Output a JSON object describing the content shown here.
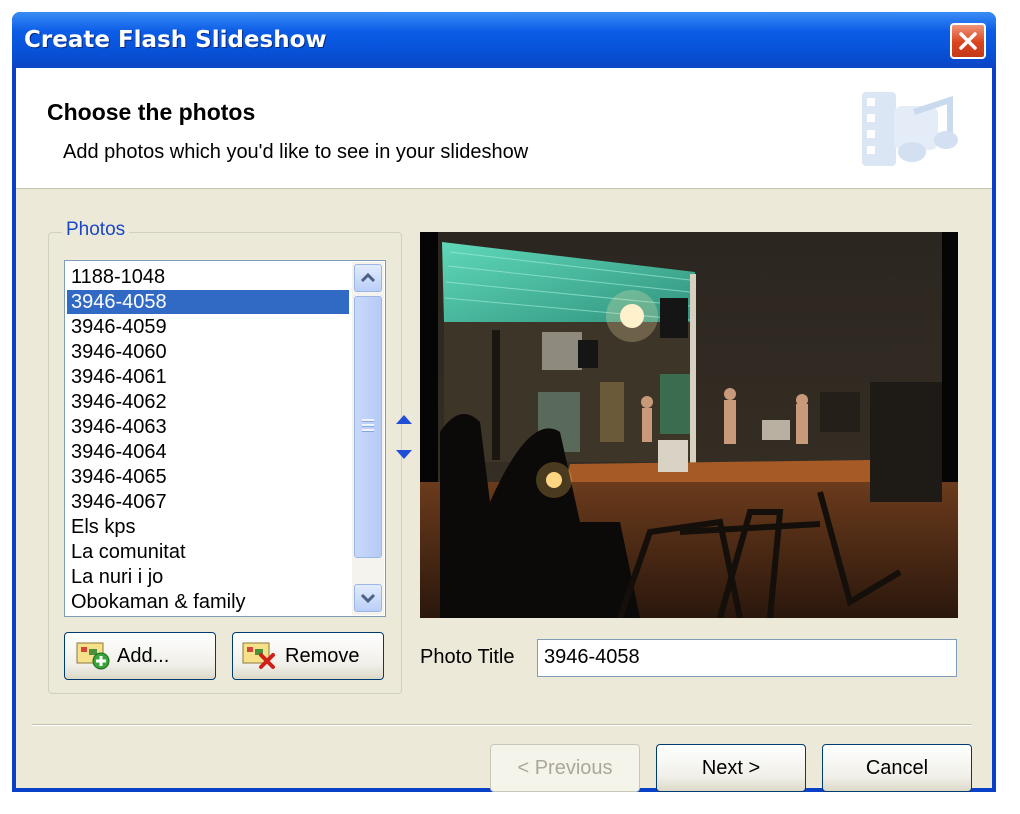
{
  "window": {
    "title": "Create Flash Slideshow"
  },
  "header": {
    "title": "Choose the photos",
    "subtitle": "Add photos which you'd like to see in your slideshow"
  },
  "photos_group": {
    "label": "Photos",
    "items": [
      "1188-1048",
      "3946-4058",
      "3946-4059",
      "3946-4060",
      "3946-4061",
      "3946-4062",
      "3946-4063",
      "3946-4064",
      "3946-4065",
      "3946-4067",
      "Els kps",
      "La comunitat",
      "La nuri i jo",
      "Obokaman & family"
    ],
    "selected_index": 1,
    "add_label": "Add...",
    "remove_label": "Remove"
  },
  "photo_title": {
    "label": "Photo Title",
    "value": "3946-4058"
  },
  "footer": {
    "previous_label": "< Previous",
    "next_label": "Next >",
    "cancel_label": "Cancel"
  },
  "colors": {
    "titlebar": "#0852d8",
    "selection": "#316ac5",
    "dialog_bg": "#ece9d8",
    "group_label": "#1a47c8"
  }
}
